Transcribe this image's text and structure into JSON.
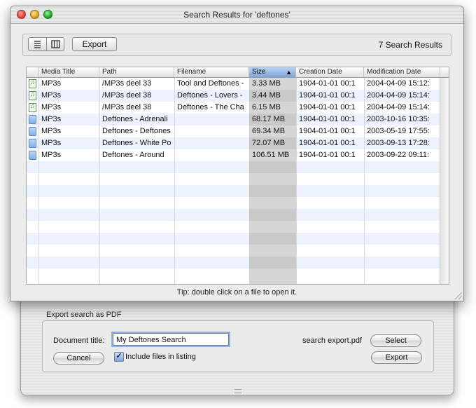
{
  "window": {
    "title": "Search Results for 'deftones'",
    "results_count": "7 Search Results",
    "tip": "Tip: double click on a file to open it."
  },
  "toolbar": {
    "export_label": "Export",
    "list_view_icon": "list-icon",
    "column_view_icon": "columns-icon"
  },
  "table": {
    "columns": [
      "Media Title",
      "Path",
      "Filename",
      "Size",
      "Creation Date",
      "Modification Date"
    ],
    "sorted_column": "Size",
    "rows": [
      {
        "icon": "mp3-file-icon",
        "media": "MP3s",
        "path": "/MP3s deel 33",
        "file": "Tool and Deftones -",
        "size": "3.33 MB",
        "created": "1904-01-01 00:1",
        "modified": "2004-04-09 15:12:"
      },
      {
        "icon": "mp3-file-icon",
        "media": "MP3s",
        "path": "/MP3s deel 38",
        "file": "Deftones - Lovers -",
        "size": "3.44 MB",
        "created": "1904-01-01 00:1",
        "modified": "2004-04-09 15:14:"
      },
      {
        "icon": "mp3-file-icon",
        "media": "MP3s",
        "path": "/MP3s deel 38",
        "file": "Deftones - The Cha",
        "size": "6.15 MB",
        "created": "1904-01-01 00:1",
        "modified": "2004-04-09 15:14:"
      },
      {
        "icon": "folder-icon",
        "media": "MP3s",
        "path": "Deftones - Adrenali",
        "file": "",
        "size": "68.17 MB",
        "created": "1904-01-01 00:1",
        "modified": "2003-10-16 10:35:"
      },
      {
        "icon": "folder-icon",
        "media": "MP3s",
        "path": "Deftones - Deftones",
        "file": "",
        "size": "69.34 MB",
        "created": "1904-01-01 00:1",
        "modified": "2003-05-19 17:55:"
      },
      {
        "icon": "folder-icon",
        "media": "MP3s",
        "path": "Deftones - White Po",
        "file": "",
        "size": "72.07 MB",
        "created": "1904-01-01 00:1",
        "modified": "2003-09-13 17:28:"
      },
      {
        "icon": "folder-icon",
        "media": "MP3s",
        "path": "Deftones - Around",
        "file": "",
        "size": "106.51 MB",
        "created": "1904-01-01 00:1",
        "modified": "2003-09-22 09:11:"
      }
    ]
  },
  "pdf_export": {
    "group_title": "Export search as PDF",
    "document_title_label": "Document title:",
    "document_title_value": "My Deftones Search",
    "file_name": "search export.pdf",
    "select_label": "Select",
    "cancel_label": "Cancel",
    "include_label": "Include files in listing",
    "include_checked": true,
    "export_label": "Export"
  },
  "colors": {
    "stripe": "#edf3fe",
    "sorted_header": "#7ea4d8",
    "close": "#e0443e",
    "minimize": "#dea123",
    "zoom": "#1aab29"
  }
}
